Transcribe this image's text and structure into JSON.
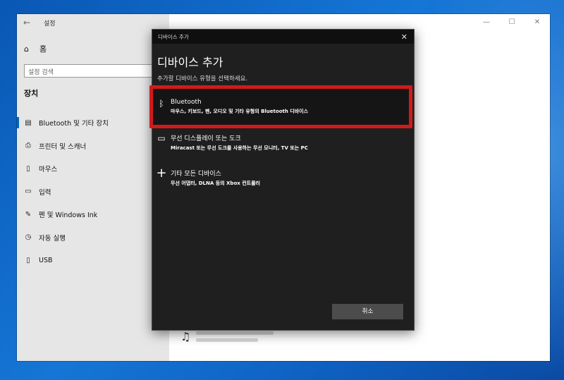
{
  "settings": {
    "title": "설정",
    "home_label": "홈",
    "search_placeholder": "설정 검색",
    "section_title": "장치",
    "nav_items": [
      {
        "label": "Bluetooth 및 기타 장치",
        "icon": "devices-icon"
      },
      {
        "label": "프린터 및 스캐너",
        "icon": "printer-icon"
      },
      {
        "label": "마우스",
        "icon": "mouse-icon"
      },
      {
        "label": "입력",
        "icon": "keyboard-icon"
      },
      {
        "label": "펜 및 Windows Ink",
        "icon": "pen-icon"
      },
      {
        "label": "자동 실행",
        "icon": "autoplay-icon"
      },
      {
        "label": "USB",
        "icon": "usb-icon"
      }
    ],
    "window_controls": {
      "minimize": "—",
      "maximize": "☐",
      "close": "✕"
    }
  },
  "dialog": {
    "title": "디바이스 추가",
    "heading": "디바이스 추가",
    "subtitle": "추가할 디바이스 유형을 선택하세요.",
    "close_glyph": "✕",
    "options": [
      {
        "name": "Bluetooth",
        "desc": "마우스, 키보드, 펜, 오디오 및 기타 유형의 Bluetooth 디바이스",
        "icon": "bluetooth-icon"
      },
      {
        "name": "무선 디스플레이 또는 도크",
        "desc": "Miracast 또는 무선 도크를 사용하는 무선 모니터, TV 또는 PC",
        "icon": "monitor-icon"
      },
      {
        "name": "기타 모든 디바이스",
        "desc": "무선 어댑터, DLNA 등의 Xbox 컨트롤러",
        "icon": "plus-icon"
      }
    ],
    "cancel_label": "취소"
  },
  "colors": {
    "highlight": "#d11a1a",
    "dialog_bg": "#1f1f1f",
    "accent": "#0067c0"
  }
}
